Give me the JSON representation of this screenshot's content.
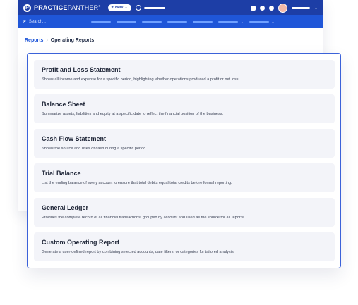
{
  "app": {
    "logo_mark": "P",
    "logo_bold": "PRACTICE",
    "logo_light": "PANTHER",
    "logo_reg": "®",
    "new_button": "New",
    "new_plus": "+",
    "new_chevron": "⌄",
    "user_chevron": "⌄"
  },
  "search": {
    "icon": "search-icon",
    "placeholder": "Search...",
    "nav_chevron": "⌄"
  },
  "breadcrumb": {
    "parent": "Reports",
    "separator": "›",
    "current": "Operating Reports"
  },
  "colors": {
    "topbar": "#1d3ea6",
    "searchbar": "#1f56d8",
    "accent": "#3b62d9",
    "card_bg": "#f3f4f9"
  },
  "reports": [
    {
      "title": "Profit and Loss Statement",
      "description": "Shows all income and expense for a specific period, highlighting whether operations produced a profit or net loss."
    },
    {
      "title": "Balance Sheet",
      "description": "Summarize assets, liabilities and equity at a specific date to reflect the financial position of the business."
    },
    {
      "title": "Cash Flow Statement",
      "description": "Shows the source and uses of cash during a specific period."
    },
    {
      "title": "Trial Balance",
      "description": "List the ending balance of every account to ensure that total debits equal total credits before formal reporting."
    },
    {
      "title": "General Ledger",
      "description": "Provides the complete record of all financial transactions, grouped by account and used as the source for all reports."
    },
    {
      "title": "Custom Operating Report",
      "description": "Generate a user-defined report by combining selected accounts, date filters, or categories for tailored analysis."
    }
  ]
}
